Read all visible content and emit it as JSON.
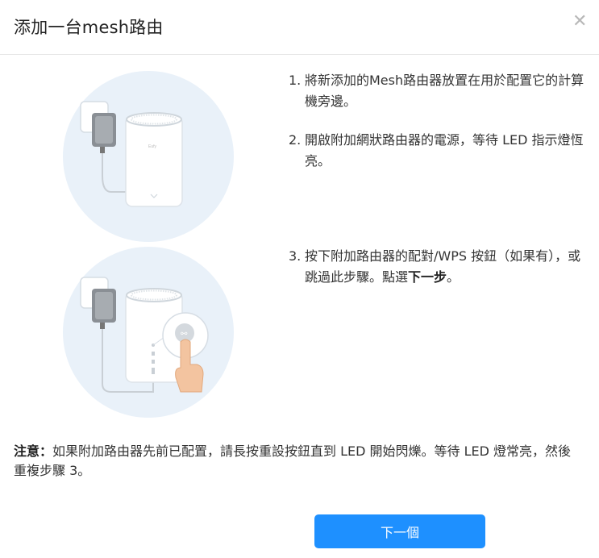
{
  "dialog": {
    "title": "添加一台mesh路由",
    "close_icon": "close-icon"
  },
  "steps": [
    {
      "num": "1.",
      "text": "將新添加的Mesh路由器放置在用於配置它的計算機旁邊。"
    },
    {
      "num": "2.",
      "text": "開啟附加網狀路由器的電源，等待 LED 指示燈恆亮。"
    },
    {
      "num": "3.",
      "text_before": "按下附加路由器的配對/WPS 按鈕（如果有），或跳過此步驟。點選",
      "text_bold": "下一步",
      "text_after": "。"
    }
  ],
  "note": {
    "label": "注意：",
    "text": "如果附加路由器先前已配置，請長按重設按鈕直到 LED 開始閃爍。等待 LED 燈常亮，然後重複步驟 3。"
  },
  "buttons": {
    "next": "下一個"
  },
  "device": {
    "brand_label": "Eufy"
  },
  "colors": {
    "primary": "#1e90ff",
    "illustration_bg": "#e9f1f9"
  }
}
